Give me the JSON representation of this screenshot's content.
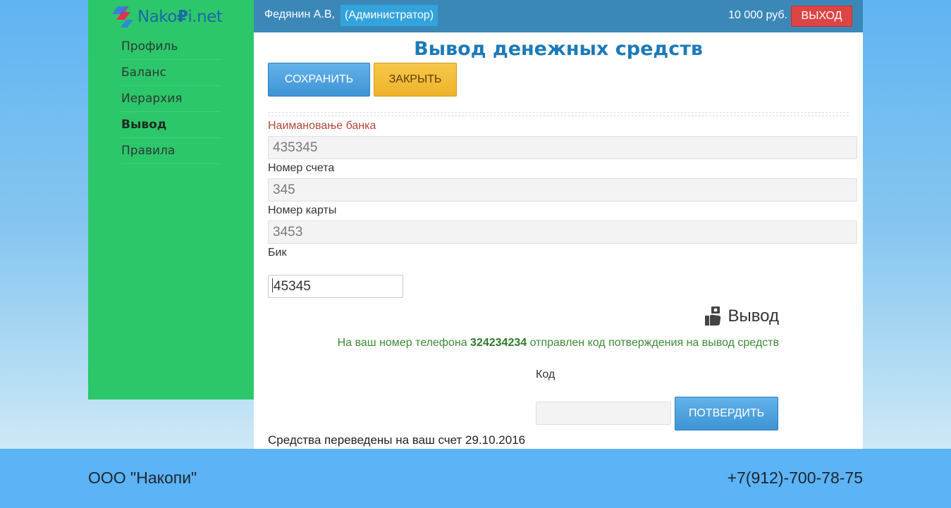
{
  "brand": {
    "logo_text_a": "Nako",
    "logo_text_rub": "₽",
    "logo_text_b": "i.net"
  },
  "sidebar": {
    "items": [
      {
        "label": "Профиль"
      },
      {
        "label": "Баланс"
      },
      {
        "label": "Иерархия"
      },
      {
        "label": "Вывод",
        "active": true
      },
      {
        "label": "Правила"
      }
    ]
  },
  "header": {
    "user_name": "Федянин А.В,",
    "role": "(Администратор)",
    "balance": "10 000 руб.",
    "logout_label": "ВЫХОД"
  },
  "main": {
    "title": "Вывод денежных средств",
    "save_label": "СОХРАНИТЬ",
    "close_label": "ЗАКРЫТЬ",
    "fields": {
      "bank_label": "Наимановање банка",
      "bank_value": "435345",
      "account_label": "Номер счета",
      "account_value": "345",
      "card_label": "Номер карты",
      "card_value": "3453",
      "bik_label": "Бик",
      "bik_value": "45345"
    },
    "withdraw_heading": "Вывод",
    "sms_prefix": "На ваш номер телефона",
    "sms_phone": "324234234",
    "sms_suffix": "отправлен код потверждения на вывод средств",
    "code_label": "Код",
    "code_value": "",
    "confirm_label": "ПОТВЕРДИТЬ",
    "transfer_message": "Средства переведены на ваш счет 29.10.2016"
  },
  "footer": {
    "company": "ООО \"Накопи\"",
    "phone": "+7(912)-700-78-75"
  },
  "colors": {
    "sidebar": "#2dc76b",
    "topbar": "#3b88b8",
    "title": "#1d7ab7",
    "primary_button": "#4a9fdc",
    "warning_button": "#f2bb35",
    "danger_button": "#dd4444",
    "success_text": "#3d8a36"
  },
  "icons": {
    "withdraw": "hand-money-icon"
  }
}
